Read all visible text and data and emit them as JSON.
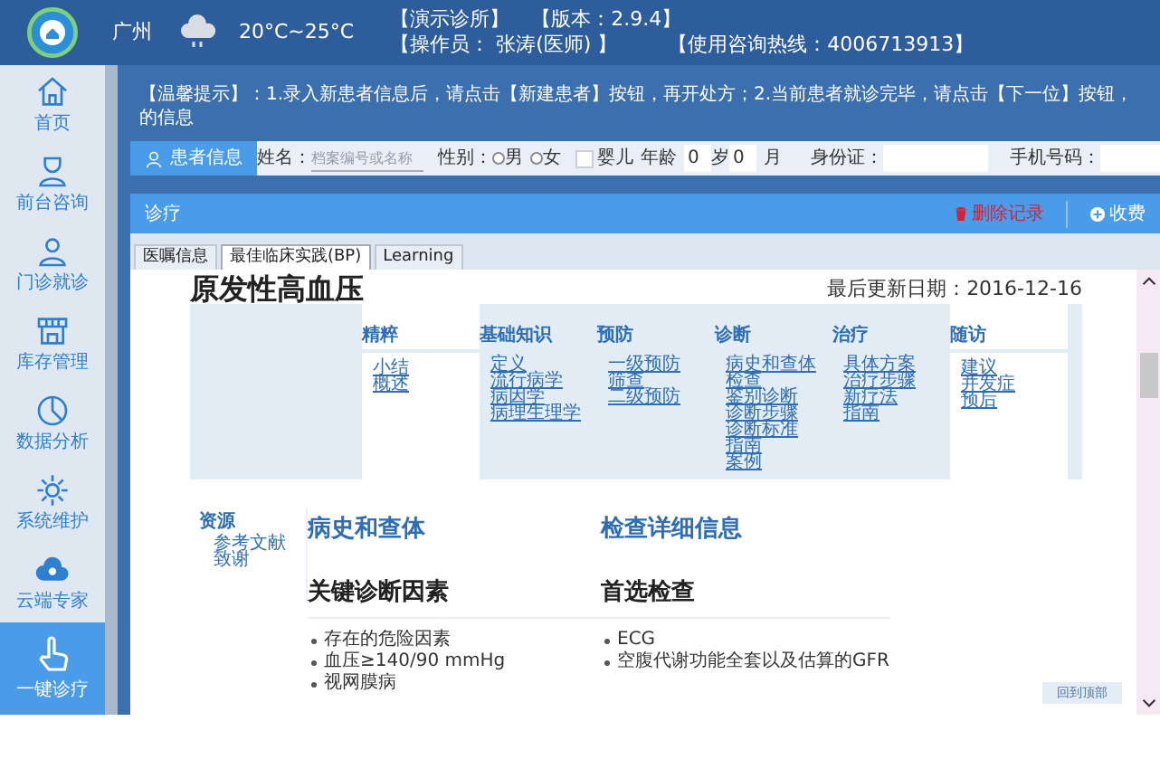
{
  "header": {
    "city": "广州",
    "temperature": "20°C~25°C",
    "clinic": "【演示诊所】",
    "version": "【版本：2.9.4】",
    "operator": "【操作员： 张涛(医师) 】",
    "hotline": "【使用咨询热线：4006713913】"
  },
  "sidebar": {
    "items": [
      {
        "label": "首页",
        "selected": false
      },
      {
        "label": "前台咨询",
        "selected": false
      },
      {
        "label": "门诊就诊",
        "selected": false
      },
      {
        "label": "库存管理",
        "selected": false
      },
      {
        "label": "数据分析",
        "selected": false
      },
      {
        "label": "系统维护",
        "selected": false
      },
      {
        "label": "云端专家",
        "selected": false
      },
      {
        "label": "一键诊疗",
        "selected": true
      }
    ]
  },
  "tip": "【温馨提示】：1.录入新患者信息后，请点击【新建患者】按钮，再开处方；2.当前患者就诊完毕，请点击【下一位】按钮，的信息",
  "patient_bar": {
    "button": "患者信息",
    "name_label": "姓名：",
    "name_placeholder": "档案编号或名称",
    "gender_label": "性别：",
    "genders": [
      {
        "label": "男",
        "selected": false
      },
      {
        "label": "女",
        "selected": false
      }
    ],
    "infant": {
      "label": "婴儿",
      "checked": false
    },
    "age_label": "年龄",
    "age_years": "0",
    "years_unit": "岁",
    "age_months": "0",
    "months_unit": "月",
    "id_label": "身份证：",
    "phone_label": "手机号码："
  },
  "panel": {
    "title": "诊疗",
    "actions": [
      {
        "kind": "delete",
        "label": "删除记录"
      },
      {
        "kind": "add",
        "label": "收费"
      }
    ]
  },
  "tabs": [
    {
      "label": "医嘱信息",
      "selected": false
    },
    {
      "label": "最佳临床实践(BP)",
      "selected": true
    },
    {
      "label": "Learning",
      "selected": false
    }
  ],
  "article": {
    "title": "原发性高血压",
    "updated": "最后更新日期：2016-12-16",
    "nav": [
      {
        "heading": "精粹",
        "boxed": true,
        "links": [
          "小结",
          "概述"
        ]
      },
      {
        "heading": "基础知识",
        "boxed": false,
        "links": [
          "定义",
          "流行病学",
          "病因学",
          "病理生理学"
        ]
      },
      {
        "heading": "预防",
        "boxed": false,
        "links": [
          "一级预防",
          "筛查",
          "二级预防"
        ]
      },
      {
        "heading": "诊断",
        "boxed": false,
        "links": [
          "病史和查体",
          "检查",
          "鉴别诊断",
          "诊断步骤",
          "诊断标准",
          "指南",
          "案例"
        ]
      },
      {
        "heading": "治疗",
        "boxed": false,
        "links": [
          "具体方案",
          "治疗步骤",
          "新疗法",
          "指南"
        ]
      },
      {
        "heading": "随访",
        "boxed": true,
        "links": [
          "建议",
          "并发症",
          "预后"
        ]
      }
    ],
    "resources": {
      "heading": "资源",
      "links": [
        "参考文献",
        "致谢"
      ]
    },
    "sections": [
      {
        "heading": "病史和查体",
        "subheading": "关键诊断因素",
        "bullets": [
          "存在的危险因素",
          "血压≥140/90 mmHg",
          "视网膜病"
        ]
      },
      {
        "heading": "检查详细信息",
        "subheading": "首选检查",
        "bullets": [
          "ECG",
          "空腹代谢功能全套以及估算的GFR"
        ]
      }
    ],
    "back_to_top": "回到顶部"
  }
}
